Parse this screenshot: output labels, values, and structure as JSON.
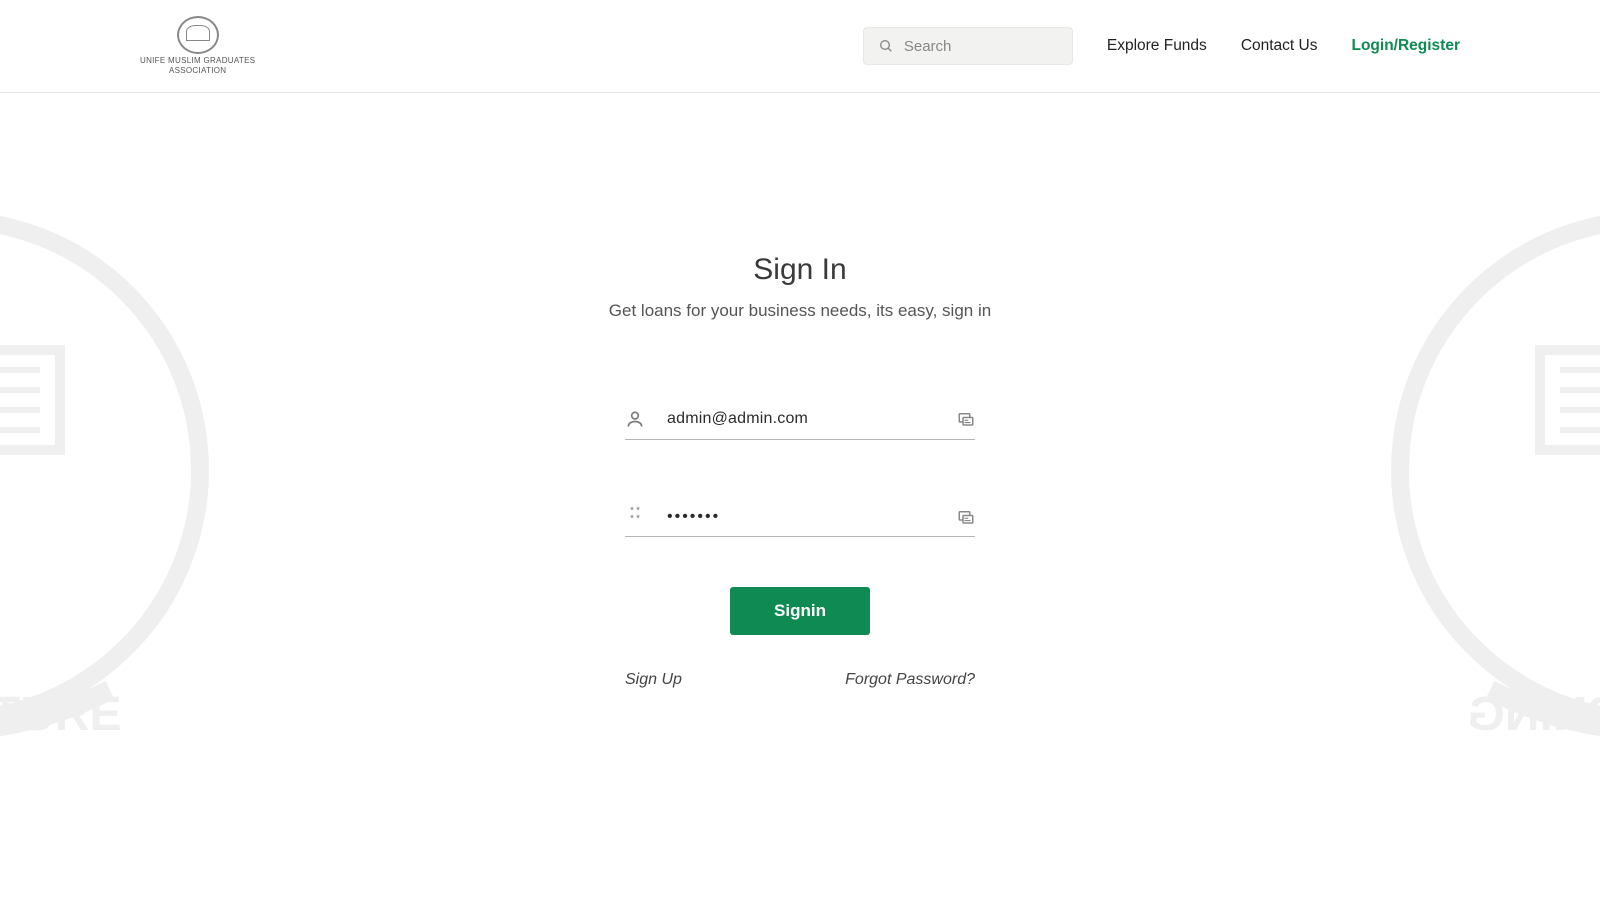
{
  "header": {
    "logo_line1": "UNIFE MUSLIM GRADUATES",
    "logo_line2": "ASSOCIATION",
    "search_placeholder": "Search",
    "nav": {
      "explore": "Explore Funds",
      "contact": "Contact Us",
      "login": "Login/Register"
    }
  },
  "signin": {
    "title": "Sign In",
    "subtitle": "Get loans for your business needs, its easy, sign in",
    "email_value": "admin@admin.com",
    "password_value": "•••••••",
    "button": "Signin",
    "signup": "Sign Up",
    "forgot": "Forgot Password?"
  },
  "colors": {
    "accent": "#0f8a52"
  }
}
